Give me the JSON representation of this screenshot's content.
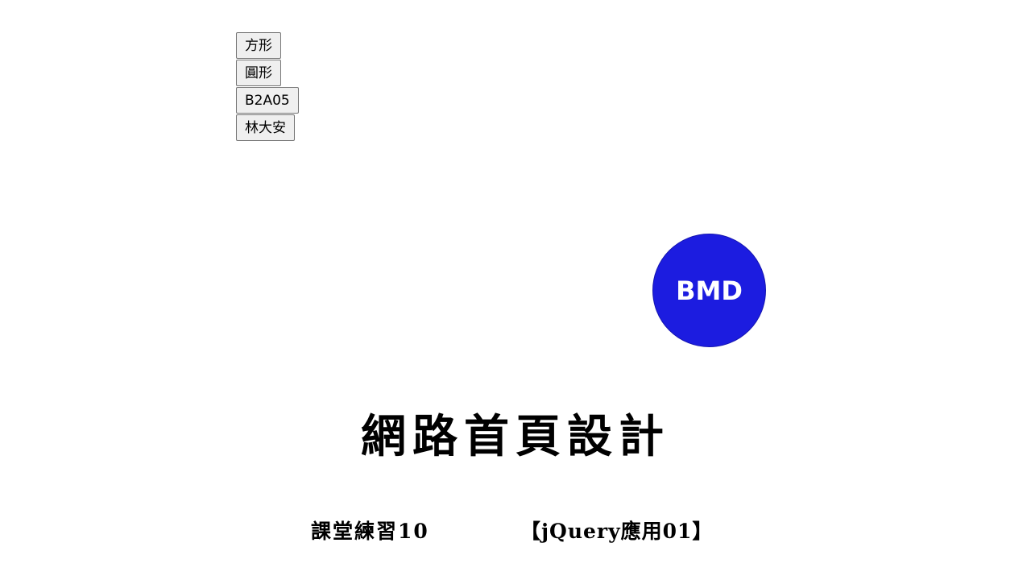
{
  "buttons": {
    "square_label": "方形",
    "circle_label": "圓形",
    "class_label": "B2A05",
    "name_label": "林大安"
  },
  "shape": {
    "label": "BMD",
    "fill_color": "#1c1ce0",
    "text_color": "#ffffff"
  },
  "title": "網路首頁設計",
  "subtitle": {
    "left": "課堂練習10",
    "right": "【jQuery應用01】"
  }
}
